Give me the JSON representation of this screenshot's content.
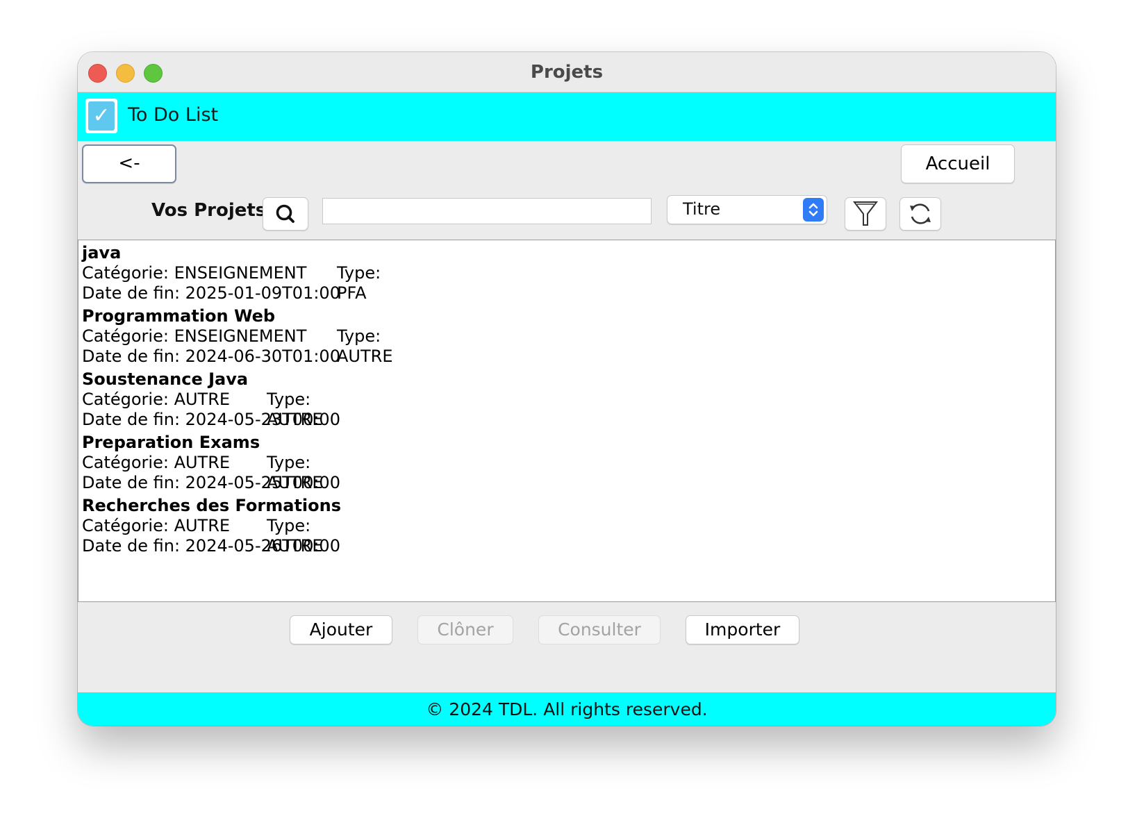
{
  "window": {
    "title": "Projets"
  },
  "header": {
    "app_name": "To Do List"
  },
  "nav": {
    "back_label": "<-",
    "home_label": "Accueil"
  },
  "toolbar": {
    "section_label": "Vos Projets",
    "search_value": "",
    "sort_selected": "Titre"
  },
  "projects": [
    {
      "title": "java",
      "category": "Catégorie: ENSEIGNEMENT",
      "type": "Type: PFA",
      "end_date": "Date de fin: 2025-01-09T01:00"
    },
    {
      "title": "Programmation Web",
      "category": "Catégorie: ENSEIGNEMENT",
      "type": "Type: AUTRE",
      "end_date": "Date de fin: 2024-06-30T01:00"
    },
    {
      "title": "Soustenance Java",
      "category": "Catégorie: AUTRE",
      "type": "Type: AUTRE",
      "end_date": "Date de fin: 2024-05-23T00:00"
    },
    {
      "title": "Preparation Exams",
      "category": "Catégorie: AUTRE",
      "type": "Type: AUTRE",
      "end_date": "Date de fin: 2024-05-25T00:00"
    },
    {
      "title": "Recherches des Formations",
      "category": "Catégorie: AUTRE",
      "type": "Type: AUTRE",
      "end_date": "Date de fin: 2024-05-26T00:00"
    }
  ],
  "actions": {
    "add_label": "Ajouter",
    "clone_label": "Clôner",
    "consult_label": "Consulter",
    "import_label": "Importer"
  },
  "footer": {
    "text": "© 2024 TDL. All rights reserved."
  },
  "colors": {
    "accent_band": "#00ffff",
    "select_arrow": "#2f7cf6"
  },
  "icons": [
    "search-icon",
    "filter-icon",
    "refresh-icon",
    "checkbox-icon",
    "chevron-updown-icon"
  ]
}
